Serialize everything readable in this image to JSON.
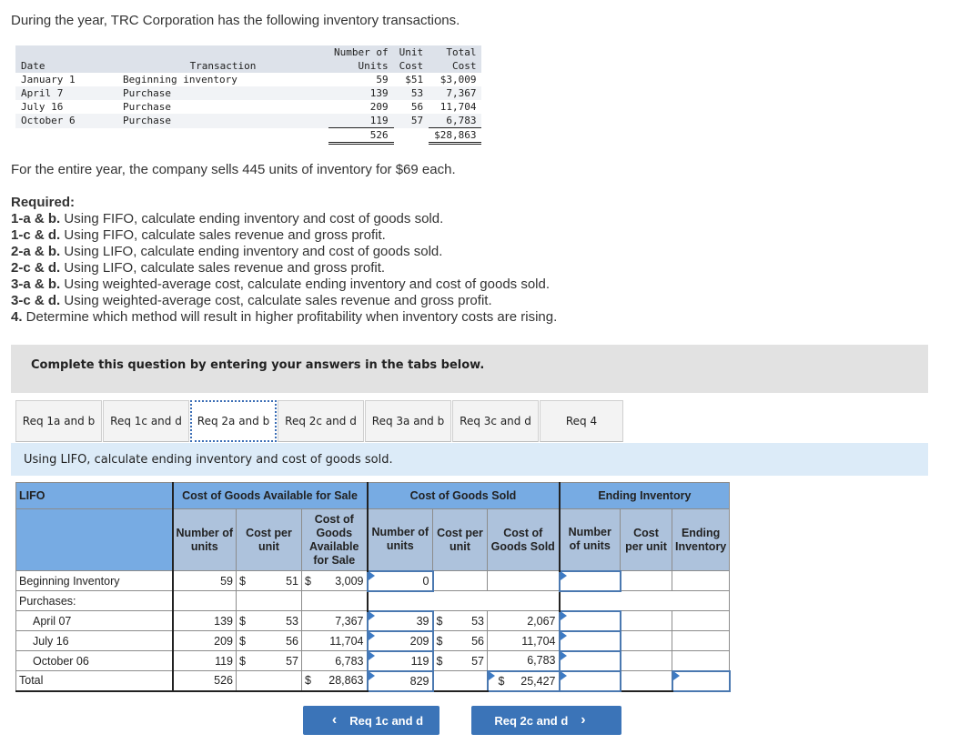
{
  "intro": "During the year, TRC Corporation has the following inventory transactions.",
  "inventory_table": {
    "headers": {
      "date": "Date",
      "transaction": "Transaction",
      "units_top": "Number of",
      "units": "Units",
      "unit_cost_top": "Unit",
      "unit_cost": "Cost",
      "total_cost_top": "Total",
      "total_cost": "Cost"
    },
    "rows": [
      {
        "date": "January 1",
        "transaction": "Beginning inventory",
        "units": "59",
        "unit_cost": "$51",
        "total_cost": "$3,009"
      },
      {
        "date": "April 7",
        "transaction": "Purchase",
        "units": "139",
        "unit_cost": "53",
        "total_cost": "7,367"
      },
      {
        "date": "July 16",
        "transaction": "Purchase",
        "units": "209",
        "unit_cost": "56",
        "total_cost": "11,704"
      },
      {
        "date": "October 6",
        "transaction": "Purchase",
        "units": "119",
        "unit_cost": "57",
        "total_cost": "6,783"
      }
    ],
    "total_units": "526",
    "total_cost": "$28,863"
  },
  "sells_text": "For the entire year, the company sells 445 units of inventory for $69 each.",
  "required": {
    "heading": "Required:",
    "items": [
      {
        "label": "1-a & b.",
        "text": " Using FIFO, calculate ending inventory and cost of goods sold."
      },
      {
        "label": "1-c & d.",
        "text": " Using FIFO, calculate sales revenue and gross profit."
      },
      {
        "label": "2-a & b.",
        "text": " Using LIFO, calculate ending inventory and cost of goods sold."
      },
      {
        "label": "2-c & d.",
        "text": " Using LIFO, calculate sales revenue and gross profit."
      },
      {
        "label": "3-a & b.",
        "text": " Using weighted-average cost, calculate ending inventory and cost of goods sold."
      },
      {
        "label": "3-c & d.",
        "text": " Using weighted-average cost, calculate sales revenue and gross profit."
      },
      {
        "label": "4.",
        "text": " Determine which method will result in higher profitability when inventory costs are rising."
      }
    ]
  },
  "banner": "Complete this question by entering your answers in the tabs below.",
  "tabs": [
    "Req 1a and b",
    "Req 1c and d",
    "Req 2a and b",
    "Req 2c and d",
    "Req 3a and b",
    "Req 3c and d",
    "Req 4"
  ],
  "active_tab": "Req 2a and b",
  "instruction": "Using LIFO, calculate ending inventory and cost of goods sold.",
  "grid": {
    "method": "LIFO",
    "group_headers": {
      "available": "Cost of Goods Available for Sale",
      "cogs": "Cost of Goods Sold",
      "ending": "Ending Inventory"
    },
    "sub_headers": {
      "avail_units": "Number of units",
      "avail_cost": "Cost per unit",
      "avail_total": "Cost of Goods Available for Sale",
      "cogs_units": "Number of units",
      "cogs_cost": "Cost per unit",
      "cogs_total": "Cost of Goods Sold",
      "end_units": "Number of units",
      "end_cost": "Cost per unit",
      "end_total": "Ending Inventory"
    },
    "currency": "$",
    "beginning": {
      "label": "Beginning Inventory",
      "avail_units": "59",
      "avail_cost": "51",
      "avail_total": "3,009",
      "cogs_units": "0",
      "end_units": ""
    },
    "purchases_label": "Purchases:",
    "purchases": [
      {
        "label": "April 07",
        "avail_units": "139",
        "avail_cost": "53",
        "avail_total": "7,367",
        "cogs_units": "39",
        "cogs_cost": "53",
        "cogs_total": "2,067",
        "end_units": ""
      },
      {
        "label": "July 16",
        "avail_units": "209",
        "avail_cost": "56",
        "avail_total": "11,704",
        "cogs_units": "209",
        "cogs_cost": "56",
        "cogs_total": "11,704",
        "end_units": ""
      },
      {
        "label": "October 06",
        "avail_units": "119",
        "avail_cost": "57",
        "avail_total": "6,783",
        "cogs_units": "119",
        "cogs_cost": "57",
        "cogs_total": "6,783",
        "end_units": ""
      }
    ],
    "total": {
      "label": "Total",
      "avail_units": "526",
      "avail_total": "28,863",
      "cogs_units": "829",
      "cogs_total": "25,427",
      "end_units": "",
      "end_total": ""
    }
  },
  "nav": {
    "prev": "Req 1c and d",
    "next": "Req 2c and d"
  }
}
